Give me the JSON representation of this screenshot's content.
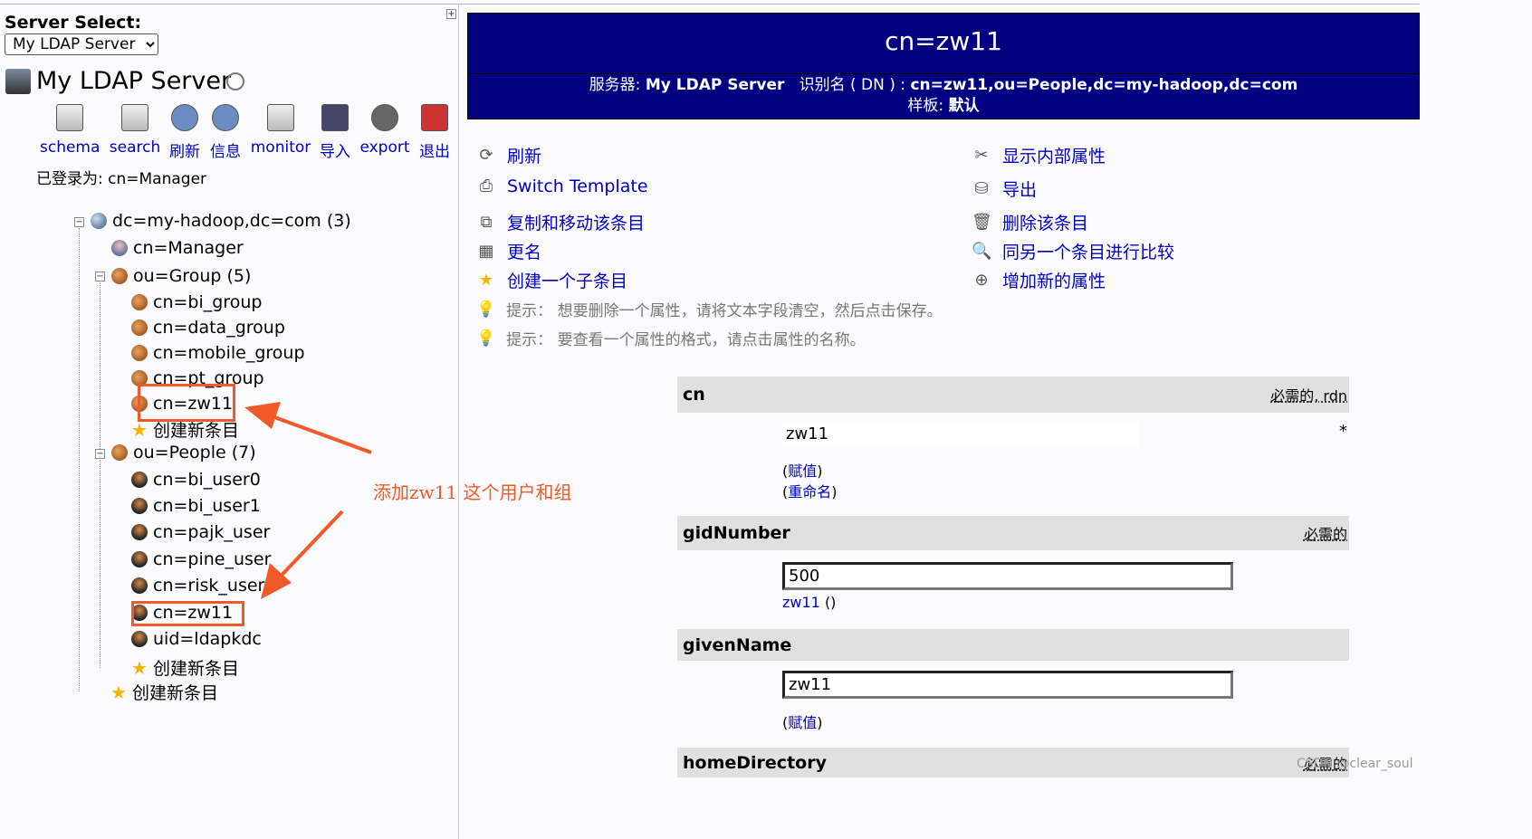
{
  "server_select": {
    "label": "Server Select:",
    "value": "My LDAP Server"
  },
  "server_title": "My LDAP Server",
  "toolbar": [
    {
      "label": "schema",
      "icon": "schema-icon"
    },
    {
      "label": "search",
      "icon": "search-icon"
    },
    {
      "label": "刷新",
      "icon": "refresh-icon"
    },
    {
      "label": "信息",
      "icon": "info-icon"
    },
    {
      "label": "monitor",
      "icon": "monitor-icon"
    },
    {
      "label": "导入",
      "icon": "import-icon"
    },
    {
      "label": "export",
      "icon": "export-icon"
    },
    {
      "label": "退出",
      "icon": "logout-icon"
    }
  ],
  "logged_in": "已登录为: cn=Manager",
  "tree": {
    "root": "dc=my-hadoop,dc=com (3)",
    "manager": "cn=Manager",
    "group": {
      "label": "ou=Group (5)",
      "items": [
        "cn=bi_group",
        "cn=data_group",
        "cn=mobile_group",
        "cn=pt_group",
        "cn=zw11"
      ],
      "create": "创建新条目"
    },
    "people": {
      "label": "ou=People (7)",
      "items": [
        "cn=bi_user0",
        "cn=bi_user1",
        "cn=pajk_user",
        "cn=pine_user",
        "cn=risk_user",
        "cn=zw11",
        "uid=ldapkdc"
      ],
      "create": "创建新条目"
    },
    "create": "创建新条目"
  },
  "annotation": "添加zw11 这个用户和组",
  "annotation_color": "#f05a28",
  "banner": {
    "title": "cn=zw11",
    "server_label": "服务器:",
    "server": "My LDAP Server",
    "dn_label": "识别名 ( DN ) :",
    "dn": "cn=zw11,ou=People,dc=my-hadoop,dc=com",
    "template_label": "样板:",
    "template": "默认"
  },
  "actions_left": [
    "刷新",
    "Switch Template",
    "复制和移动该条目",
    "更名",
    "创建一个子条目"
  ],
  "actions_right": [
    "显示内部属性",
    "导出",
    "删除该条目",
    "同另一个条目进行比较",
    "增加新的属性"
  ],
  "hints": [
    "提示： 想要删除一个属性，请将文本字段清空，然后点击保存。",
    "提示： 要查看一个属性的格式，请点击属性的名称。"
  ],
  "attrs": {
    "cn": {
      "name": "cn",
      "req": "必需的, rdn",
      "value": "zw11",
      "star": "*",
      "links": [
        "赋值",
        "重命名"
      ]
    },
    "gidNumber": {
      "name": "gidNumber",
      "req": "必需的",
      "value": "500",
      "link": "zw11",
      "paren": "()"
    },
    "givenName": {
      "name": "givenName",
      "value": "zw11",
      "link": "赋值"
    },
    "homeDirectory": {
      "name": "homeDirectory",
      "req": "必需的"
    }
  },
  "watermark": "CSDN @clear_soul"
}
